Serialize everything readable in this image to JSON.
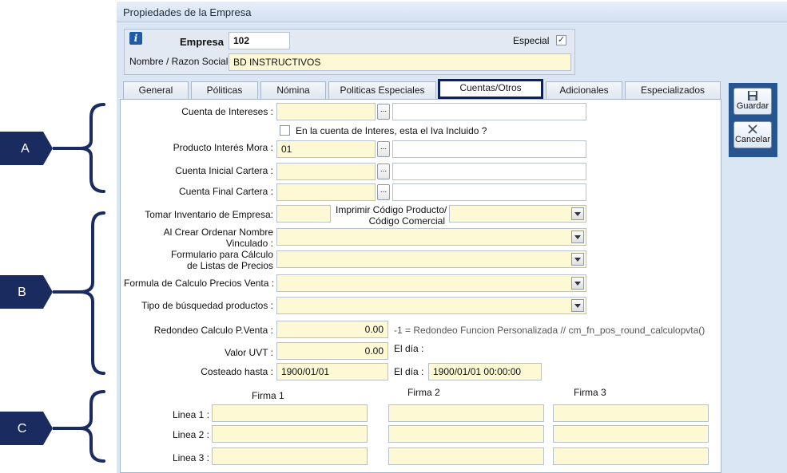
{
  "window": {
    "title": "Propiedades de la Empresa"
  },
  "header": {
    "empresa_label": "Empresa",
    "empresa_value": "102",
    "especial_label": "Especial",
    "especial_checked": true,
    "nombre_label": "Nombre / Razon Social",
    "nombre_value": "BD INSTRUCTIVOS"
  },
  "tabs": [
    {
      "label": "General"
    },
    {
      "label": "Póliticas"
    },
    {
      "label": "Nómina"
    },
    {
      "label": "Politicas Especiales"
    },
    {
      "label": "Cuentas/Otros",
      "active": true
    },
    {
      "label": "Adicionales"
    },
    {
      "label": "Especializados"
    }
  ],
  "toolbar": {
    "save_label": "Guardar",
    "cancel_label": "Cancelar"
  },
  "section_a": {
    "cuenta_intereses_label": "Cuenta de Intereses :",
    "cuenta_intereses_value": "",
    "iva_checkbox_label": "En la cuenta de Interes, esta el Iva Incluido ?",
    "iva_checked": false,
    "producto_mora_label": "Producto Interés Mora :",
    "producto_mora_value": "01",
    "cuenta_inicial_label": "Cuenta Inicial Cartera :",
    "cuenta_final_label": "Cuenta Final Cartera :",
    "browse_label": "..."
  },
  "section_b": {
    "inventario_label": "Tomar Inventario de Empresa:",
    "imprimir_label_1": "Imprimir Código Producto/",
    "imprimir_label_2": "Código Comercial",
    "ordenar_label_1": "Al Crear Ordenar Nombre",
    "ordenar_label_2": "Vinculado :",
    "formulario_label_1": "Formulario para Cálculo",
    "formulario_label_2": "de Listas de Precios",
    "formula_label": "Formula de Calculo Precios Venta :",
    "busqueda_label": "Tipo de búsquedad productos :",
    "redondeo_label": "Redondeo  Calculo P.Venta :",
    "redondeo_value": "0.00",
    "redondeo_note": "-1 = Redondeo Funcion Personalizada   // cm_fn_pos_round_calculopvta()",
    "uvt_label": "Valor UVT :",
    "uvt_value": "0.00",
    "uvt_dia_label": "El día :",
    "costeado_label": "Costeado hasta :",
    "costeado_value": "1900/01/01",
    "costeado_dia_label": "El día :",
    "costeado_dia_value": "1900/01/01 00:00:00"
  },
  "section_c": {
    "firma_headers": [
      "Firma 1",
      "Firma 2",
      "Firma 3"
    ],
    "linea_labels": [
      "Linea 1 :",
      "Linea 2 :",
      "Linea 3 :"
    ]
  },
  "markers": [
    "A",
    "B",
    "C"
  ],
  "colors": {
    "marker": "#1a2b5f",
    "field_bg": "#fdf9d5",
    "window_bg": "#dbe6f4",
    "active_tab_border": "#0b1f6b",
    "side_panel": "#26558f"
  }
}
